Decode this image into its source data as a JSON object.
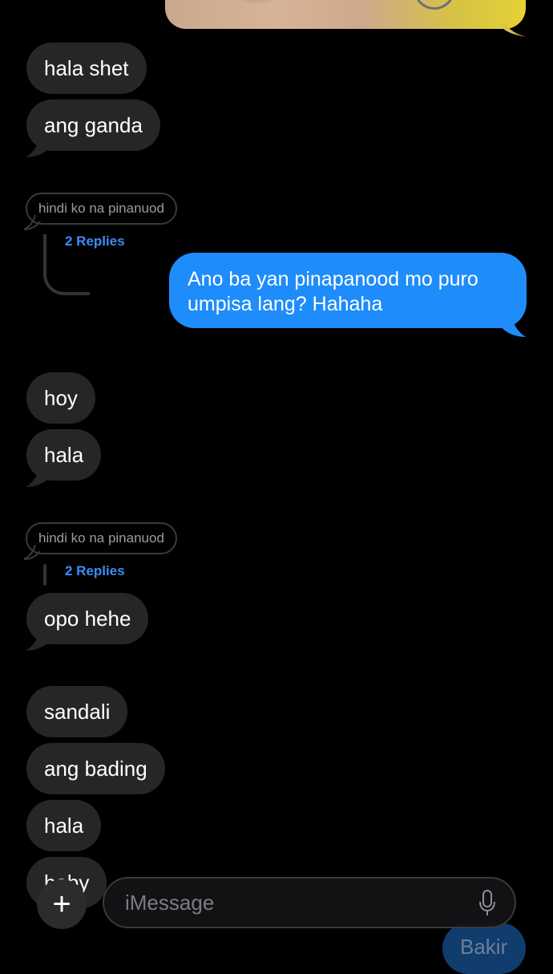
{
  "messages": {
    "m1": "hala shet",
    "m2": "ang ganda",
    "sent1": "Ano ba yan pinapanood mo puro umpisa lang? Hahaha",
    "m3": "hoy",
    "m4": "hala",
    "m5": "opo hehe",
    "m6": "sandali",
    "m7": "ang bading",
    "m8": "hala",
    "m9": "baby",
    "sent2": "Bakir"
  },
  "threads": {
    "t1": {
      "quote": "hindi ko na pinanuod",
      "replies": "2 Replies"
    },
    "t2": {
      "quote": "hindi ko na pinanuod",
      "replies": "2 Replies"
    }
  },
  "composer": {
    "placeholder": "iMessage",
    "plus_icon": "plus-icon",
    "mic_icon": "microphone-icon"
  },
  "colors": {
    "received_bubble": "#262628",
    "sent_bubble": "#1e8cfa",
    "replies_link": "#3b8df5"
  }
}
